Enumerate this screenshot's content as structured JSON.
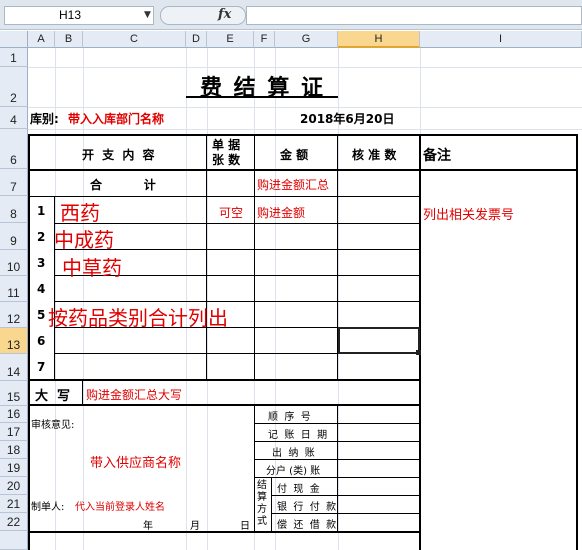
{
  "formula_bar": {
    "cell_ref": "H13",
    "fx": "fx",
    "formula": ""
  },
  "columns": [
    "A",
    "B",
    "C",
    "D",
    "E",
    "F",
    "G",
    "H",
    "I"
  ],
  "rows": [
    "1",
    "2",
    "4",
    "6",
    "7",
    "8",
    "9",
    "10",
    "11",
    "12",
    "13",
    "14",
    "15",
    "16",
    "17",
    "18",
    "19",
    "20",
    "21",
    "22"
  ],
  "selected_cell": "H13",
  "form": {
    "title": "费 结 算 证",
    "storage_label": "库别:",
    "storage_value": "带入入库部门名称",
    "date": "2018年6月20日",
    "header": {
      "item": "开 支 内 容",
      "doc_count": "单 据\n张 数",
      "amount": "金 额",
      "approved": "核 准 数",
      "remarks": "备注"
    },
    "total_row": {
      "label": "合          计",
      "amount": "购进金额汇总"
    },
    "line1": {
      "no": "1",
      "name": "西药",
      "doc": "可空",
      "amount": "购进金额"
    },
    "line2": {
      "no": "2",
      "name": "中成药"
    },
    "line3": {
      "no": "3",
      "name": "中草药"
    },
    "line4": {
      "no": "4"
    },
    "line5": {
      "no": "5",
      "name": "按药品类别合计列出"
    },
    "line6": {
      "no": "6"
    },
    "line7": {
      "no": "7"
    },
    "remarks_value": "列出相关发票号",
    "capital_label": "大  写",
    "capital_value": "购进金额汇总大写",
    "review_label": "审核意见:",
    "supplier": "带入供应商名称",
    "maker_label": "制单人:",
    "maker_value": "代入当前登录人姓名",
    "date_year": "年",
    "date_month": "月",
    "date_day": "日",
    "seq_no": "顺  序  号",
    "account_date": "记  账  日  期",
    "cashier": "出  纳  账",
    "sub_account": "分户 (类) 账",
    "settle_label": "结算方式",
    "pay_cash": "付  现  金",
    "bank_pay": "银  行  付  款",
    "repay_loan": "偿  还  借  款"
  }
}
